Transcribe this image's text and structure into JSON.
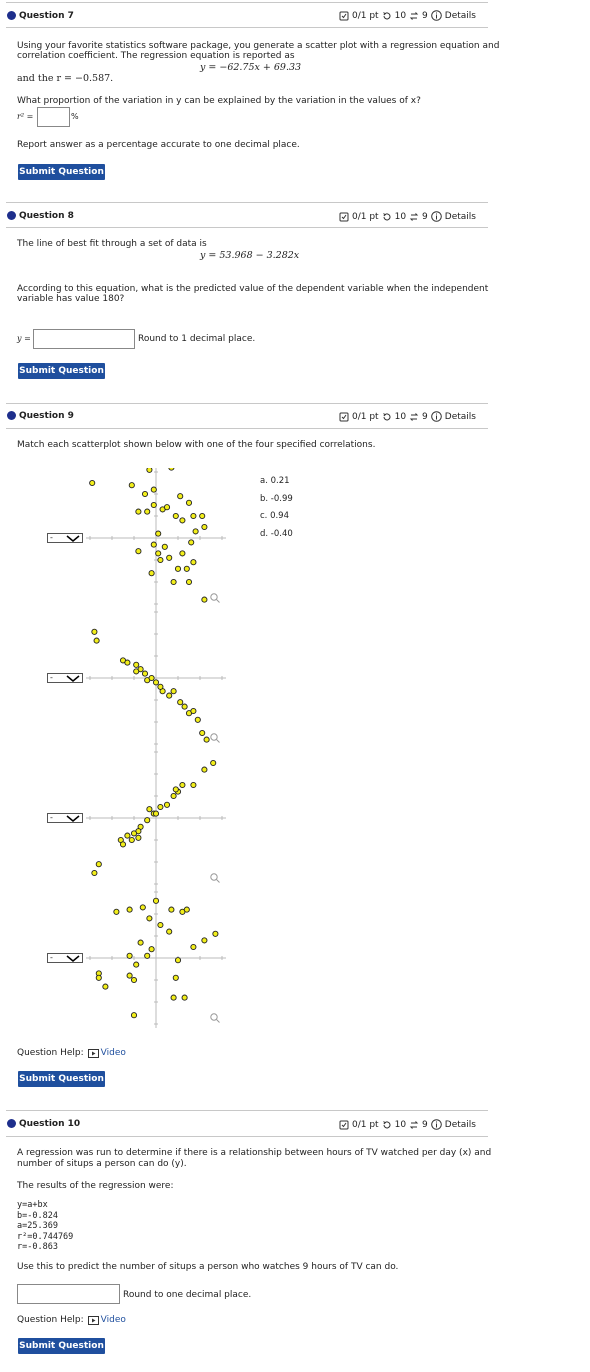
{
  "meta": {
    "score": "0/1 pt",
    "retries": "10",
    "attempts": "9",
    "details": "Details"
  },
  "submit_label": "Submit Question",
  "q7": {
    "title": "Question 7",
    "text1": "Using your favorite statistics software package, you generate a scatter plot with a regression equation and",
    "text2": "correlation coefficient. The regression equation is reported as",
    "equation": "y = −62.75x + 69.33",
    "r_text": "and the r = −0.587.",
    "question": "What proportion of the variation in y can be explained by the variation in the values of x?",
    "input_label": "r² =",
    "unit": "%",
    "instruction": "Report answer as a percentage accurate to one decimal place."
  },
  "q8": {
    "title": "Question 8",
    "text1": "The line of best fit through a set of data is",
    "equation": "y = 53.968 − 3.282x",
    "text2": "According to this equation, what is the predicted value of the dependent variable when the independent",
    "text3": "variable has value 180?",
    "input_label": "y =",
    "round_text": "Round to 1 decimal place."
  },
  "q9": {
    "title": "Question 9",
    "text": "Match each scatterplot shown below with one of the four specified correlations.",
    "options": [
      "a. 0.21",
      "b. -0.99",
      "c. 0.94",
      "d. -0.40"
    ],
    "select_value": "-",
    "help_label": "Question Help:",
    "video_label": "Video",
    "plots": [
      {
        "name": "scatterplot-1",
        "points": [
          [
            -2.9,
            2.5
          ],
          [
            -1.1,
            2.4
          ],
          [
            -0.1,
            2.2
          ],
          [
            0.7,
            3.2
          ],
          [
            1.1,
            1.9
          ],
          [
            1.5,
            1.6
          ],
          [
            0.2,
            3.4
          ],
          [
            -0.3,
            3.1
          ],
          [
            -0.5,
            2.0
          ],
          [
            -0.8,
            1.2
          ],
          [
            0.3,
            1.3
          ],
          [
            0.5,
            1.4
          ],
          [
            0.9,
            1.0
          ],
          [
            1.2,
            0.8
          ],
          [
            1.7,
            1.0
          ],
          [
            2.1,
            1.0
          ],
          [
            2.2,
            0.5
          ],
          [
            1.8,
            0.3
          ],
          [
            -0.1,
            1.5
          ],
          [
            -0.4,
            1.2
          ],
          [
            0.1,
            0.2
          ],
          [
            -0.8,
            -0.6
          ],
          [
            -0.1,
            -0.3
          ],
          [
            0.4,
            -0.4
          ],
          [
            0.6,
            -0.9
          ],
          [
            1.2,
            -0.7
          ],
          [
            1.6,
            -0.2
          ],
          [
            1.7,
            -1.1
          ],
          [
            1.4,
            -1.4
          ],
          [
            1.0,
            -1.4
          ],
          [
            0.2,
            -1.0
          ],
          [
            -0.2,
            -1.6
          ],
          [
            0.8,
            -2.0
          ],
          [
            1.5,
            -2.0
          ],
          [
            2.2,
            -2.8
          ],
          [
            0.1,
            -0.7
          ]
        ]
      },
      {
        "name": "scatterplot-2",
        "points": [
          [
            -2.8,
            2.1
          ],
          [
            -2.7,
            1.7
          ],
          [
            -1.5,
            0.8
          ],
          [
            -1.3,
            0.7
          ],
          [
            -0.9,
            0.6
          ],
          [
            -0.7,
            0.4
          ],
          [
            -0.5,
            0.2
          ],
          [
            -0.4,
            -0.1
          ],
          [
            -0.2,
            0.0
          ],
          [
            0.0,
            -0.2
          ],
          [
            0.3,
            -0.6
          ],
          [
            0.6,
            -0.8
          ],
          [
            0.8,
            -0.6
          ],
          [
            1.1,
            -1.1
          ],
          [
            1.3,
            -1.3
          ],
          [
            1.5,
            -1.6
          ],
          [
            1.7,
            -1.5
          ],
          [
            1.9,
            -1.9
          ],
          [
            2.1,
            -2.5
          ],
          [
            2.3,
            -2.8
          ],
          [
            -0.9,
            0.3
          ],
          [
            0.2,
            -0.4
          ]
        ]
      },
      {
        "name": "scatterplot-3",
        "points": [
          [
            2.6,
            2.5
          ],
          [
            2.2,
            2.2
          ],
          [
            1.7,
            1.5
          ],
          [
            1.2,
            1.5
          ],
          [
            1.0,
            1.2
          ],
          [
            0.8,
            1.0
          ],
          [
            0.5,
            0.6
          ],
          [
            0.2,
            0.5
          ],
          [
            -0.1,
            0.2
          ],
          [
            -0.4,
            -0.1
          ],
          [
            -0.7,
            -0.4
          ],
          [
            -0.8,
            -0.6
          ],
          [
            -1.0,
            -0.7
          ],
          [
            -1.3,
            -0.8
          ],
          [
            -1.6,
            -1.0
          ],
          [
            -1.5,
            -1.2
          ],
          [
            -1.1,
            -1.0
          ],
          [
            -0.8,
            -0.9
          ],
          [
            -0.3,
            0.4
          ],
          [
            0.9,
            1.3
          ],
          [
            -2.6,
            -2.1
          ],
          [
            -2.8,
            -2.5
          ],
          [
            0.0,
            0.2
          ]
        ]
      },
      {
        "name": "scatterplot-4",
        "points": [
          [
            -1.8,
            2.1
          ],
          [
            -1.2,
            2.2
          ],
          [
            -0.6,
            2.3
          ],
          [
            0.0,
            2.6
          ],
          [
            0.7,
            2.2
          ],
          [
            1.2,
            2.1
          ],
          [
            1.4,
            2.2
          ],
          [
            -0.3,
            1.8
          ],
          [
            0.2,
            1.5
          ],
          [
            0.6,
            1.2
          ],
          [
            -0.7,
            0.7
          ],
          [
            -0.2,
            0.4
          ],
          [
            -1.2,
            0.1
          ],
          [
            -0.9,
            -0.3
          ],
          [
            -1.0,
            -1.0
          ],
          [
            -1.2,
            -0.8
          ],
          [
            -2.6,
            -0.7
          ],
          [
            -2.6,
            -0.9
          ],
          [
            -2.3,
            -1.3
          ],
          [
            -1.0,
            -2.6
          ],
          [
            0.9,
            -0.9
          ],
          [
            1.0,
            -0.1
          ],
          [
            1.7,
            0.5
          ],
          [
            2.2,
            0.8
          ],
          [
            2.7,
            1.1
          ],
          [
            0.8,
            -1.8
          ],
          [
            1.3,
            -1.8
          ],
          [
            -0.4,
            0.1
          ]
        ]
      }
    ]
  },
  "q10": {
    "title": "Question 10",
    "text1": "A regression was run to determine if there is a relationship between hours of TV watched per day (x) and",
    "text2": "number of situps a person can do (y).",
    "results": "The results of the regression were:",
    "lines": [
      "y=a+bx",
      "b=-0.824",
      "a=25.369",
      "r²=0.744769",
      "r=-0.863"
    ],
    "question": "Use this to predict the number of situps a person who watches 9 hours of TV can do.",
    "round_text": "Round to one decimal place.",
    "help_label": "Question Help:",
    "video_label": "Video"
  },
  "colors": {
    "accent": "#1f4f9e",
    "dot": "#1e2f8c",
    "point_fill": "#f2ee1a"
  }
}
